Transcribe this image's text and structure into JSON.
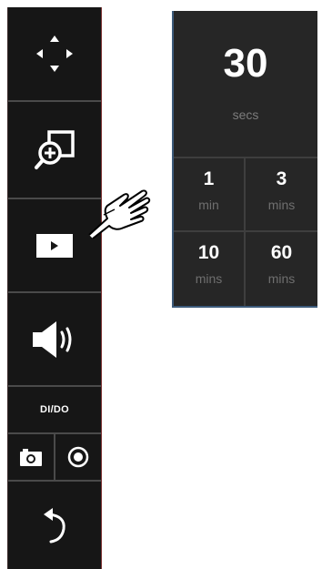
{
  "toolbar": {
    "buttons": [
      {
        "name": "pan",
        "icon": "move-arrows-icon"
      },
      {
        "name": "zoom",
        "icon": "zoom-in-icon"
      },
      {
        "name": "play",
        "icon": "play-icon"
      },
      {
        "name": "audio",
        "icon": "speaker-icon"
      },
      {
        "name": "dido",
        "label": "DI/DO"
      },
      {
        "name": "snapshot",
        "icon": "camera-icon"
      },
      {
        "name": "record",
        "icon": "record-icon"
      },
      {
        "name": "back",
        "icon": "return-arrow-icon"
      }
    ]
  },
  "duration_panel": {
    "current": {
      "value": "30",
      "unit": "secs"
    },
    "options": [
      {
        "value": "1",
        "unit": "min"
      },
      {
        "value": "3",
        "unit": "mins"
      },
      {
        "value": "10",
        "unit": "mins"
      },
      {
        "value": "60",
        "unit": "mins"
      }
    ]
  },
  "colors": {
    "toolbar_bg": "#161616",
    "panel_bg": "#262626",
    "panel_accent": "#3c5a7a",
    "text_primary": "#ffffff",
    "text_secondary": "#7c7c7c"
  }
}
